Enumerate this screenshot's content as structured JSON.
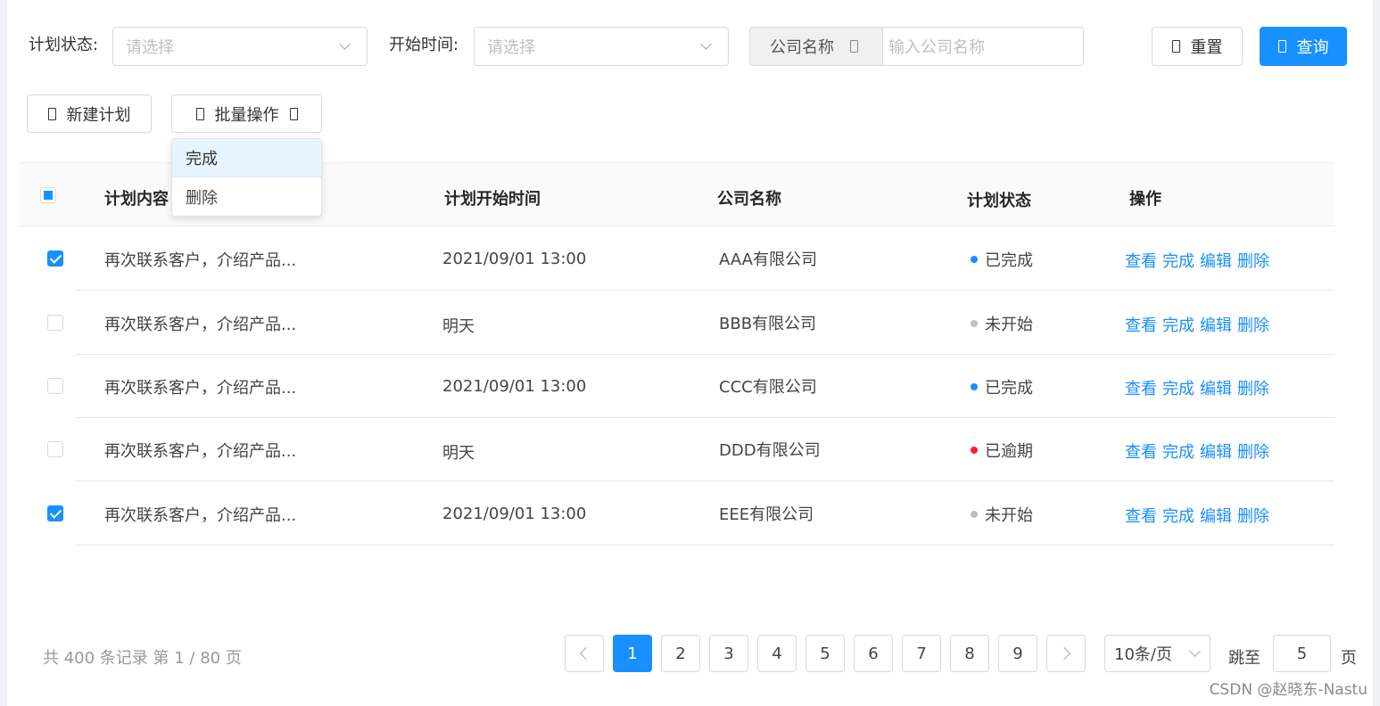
{
  "filters": {
    "plan_status_label": "计划状态:",
    "plan_status_placeholder": "请选择",
    "start_time_label": "开始时间:",
    "start_time_placeholder": "请选择",
    "company_addon": "公司名称",
    "company_placeholder": "输入公司名称",
    "reset_label": "重置",
    "query_label": "查询"
  },
  "toolbar": {
    "new_plan_label": "新建计划",
    "batch_label": "批量操作",
    "batch_menu": [
      "完成",
      "删除"
    ]
  },
  "table": {
    "headers": [
      "计划内容",
      "计划开始时间",
      "公司名称",
      "计划状态",
      "操作"
    ],
    "rows": [
      {
        "checked": true,
        "content": "再次联系客户，介绍产品...",
        "start": "2021/09/01 13:00",
        "company": "AAA有限公司",
        "status": "已完成",
        "status_color": "#1890ff"
      },
      {
        "checked": false,
        "content": "再次联系客户，介绍产品...",
        "start": "明天",
        "company": "BBB有限公司",
        "status": "未开始",
        "status_color": "#bfbfbf"
      },
      {
        "checked": false,
        "content": "再次联系客户，介绍产品...",
        "start": "2021/09/01 13:00",
        "company": "CCC有限公司",
        "status": "已完成",
        "status_color": "#1890ff"
      },
      {
        "checked": false,
        "content": "再次联系客户，介绍产品...",
        "start": "明天",
        "company": "DDD有限公司",
        "status": "已逾期",
        "status_color": "#f5222d"
      },
      {
        "checked": true,
        "content": "再次联系客户，介绍产品...",
        "start": "2021/09/01 13:00",
        "company": "EEE有限公司",
        "status": "未开始",
        "status_color": "#bfbfbf"
      }
    ],
    "actions": [
      "查看",
      "完成",
      "编辑",
      "删除"
    ]
  },
  "pagination": {
    "summary": "共 400 条记录 第 1 / 80 页",
    "pages": [
      "1",
      "2",
      "3",
      "4",
      "5",
      "6",
      "7",
      "8",
      "9"
    ],
    "current": "1",
    "page_size": "10条/页",
    "jump_label": "跳至",
    "jump_value": "5",
    "page_suffix": "页"
  },
  "watermark": "CSDN @赵晓东-Nastu",
  "colors": {
    "accent": "#1890ff",
    "danger": "#f5222d",
    "muted": "#bfbfbf"
  }
}
